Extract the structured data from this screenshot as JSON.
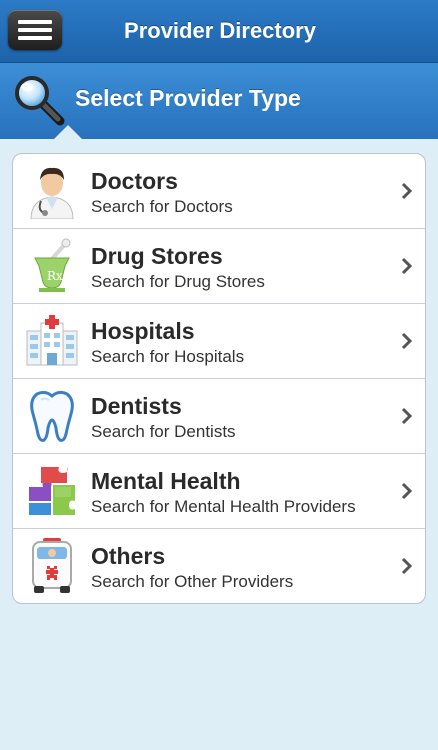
{
  "navbar": {
    "title": "Provider Directory",
    "menu_icon": "hamburger-menu-icon"
  },
  "header": {
    "title": "Select Provider Type",
    "icon": "magnifier-search-icon"
  },
  "provider_types": [
    {
      "label": "Doctors",
      "subtitle": "Search for Doctors",
      "icon": "doctor-icon"
    },
    {
      "label": "Drug Stores",
      "subtitle": "Search for Drug Stores",
      "icon": "pharmacy-mortar-icon"
    },
    {
      "label": "Hospitals",
      "subtitle": "Search for Hospitals",
      "icon": "hospital-building-icon"
    },
    {
      "label": "Dentists",
      "subtitle": "Search for Dentists",
      "icon": "tooth-icon"
    },
    {
      "label": "Mental Health",
      "subtitle": "Search for Mental Health Providers",
      "icon": "puzzle-pieces-icon"
    },
    {
      "label": "Others",
      "subtitle": "Search for Other Providers",
      "icon": "ambulance-icon"
    }
  ],
  "colors": {
    "navbar": "#1d63aa",
    "header": "#2f7cc8",
    "background": "#ddeef7",
    "chevron": "#555555"
  }
}
